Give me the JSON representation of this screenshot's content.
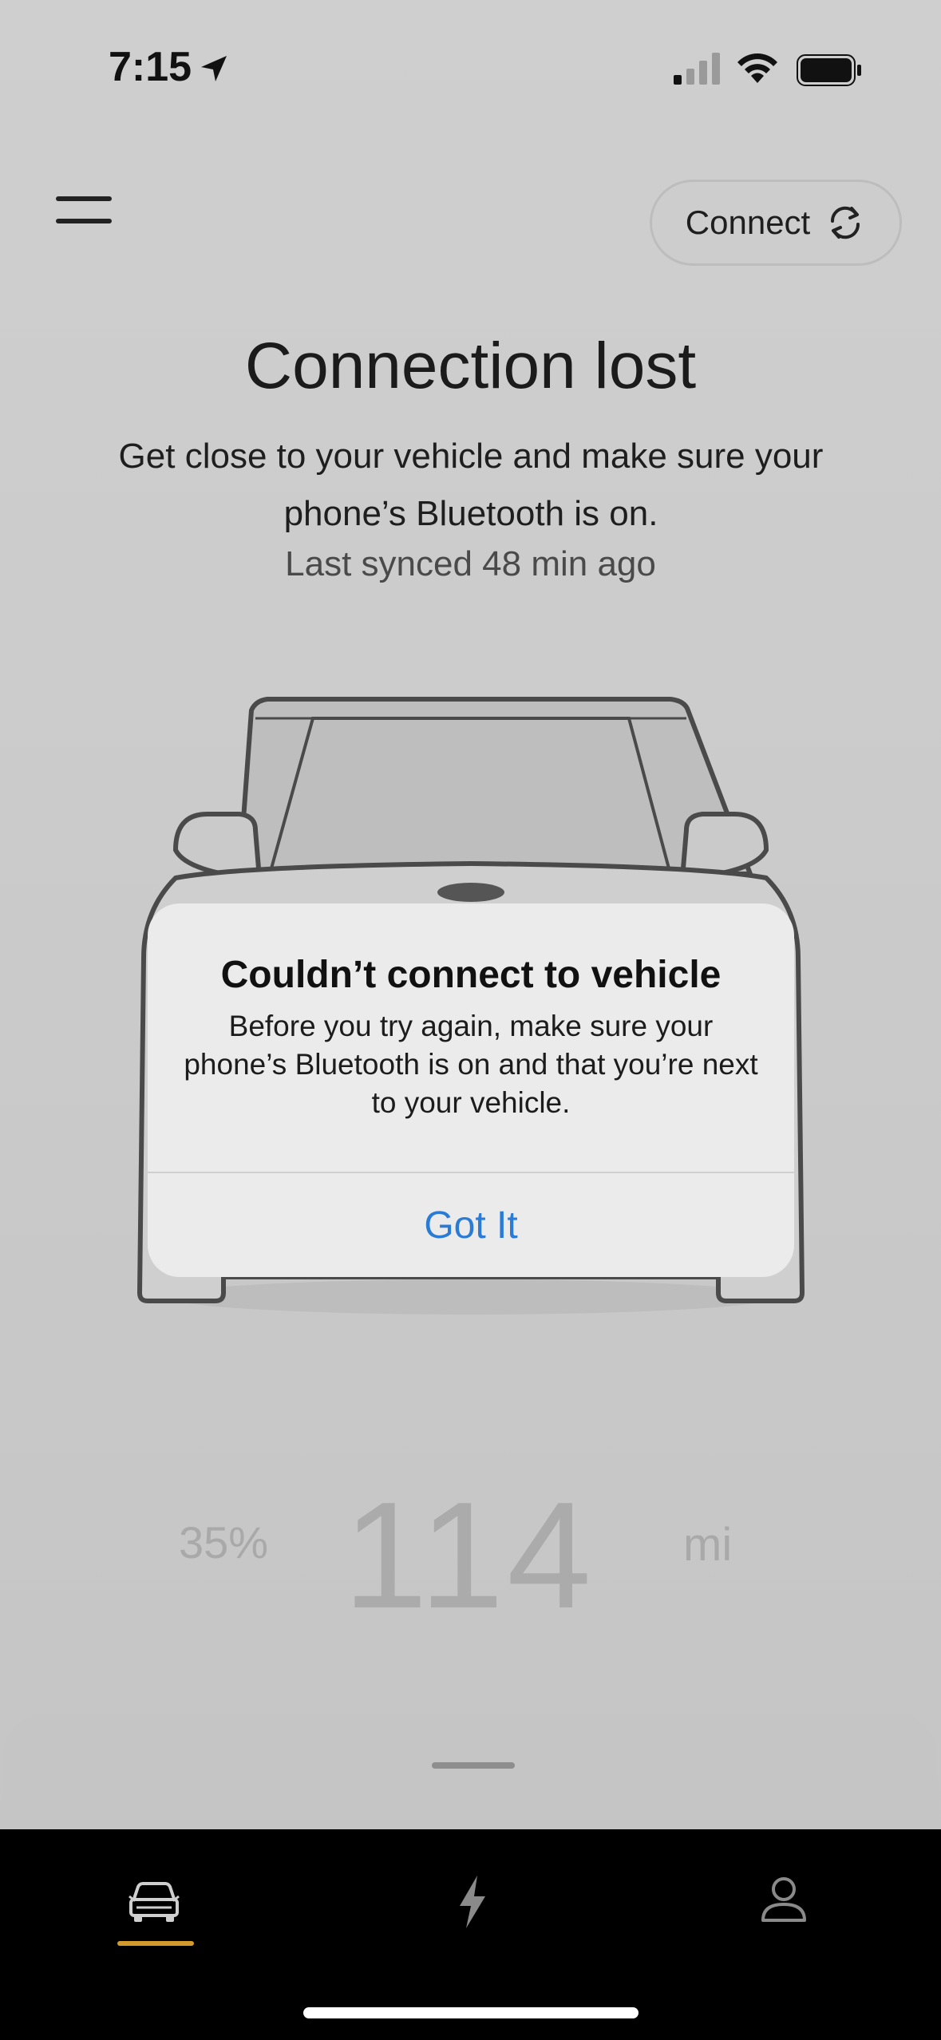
{
  "status_bar": {
    "time": "7:15"
  },
  "header": {
    "connect_label": "Connect"
  },
  "main": {
    "title": "Connection lost",
    "subtitle": "Get close to your vehicle and make sure your phone’s Bluetooth is on.",
    "last_synced": "Last synced 48 min ago"
  },
  "range": {
    "battery_percent": "35%",
    "value": "114",
    "unit": "mi"
  },
  "alert": {
    "title": "Couldn’t connect to vehicle",
    "message": "Before you try again, make sure your phone’s Bluetooth is on and that you’re next to your vehicle.",
    "button_label": "Got It"
  },
  "tabs": [
    {
      "icon": "car-icon",
      "selected": true
    },
    {
      "icon": "lightning-icon",
      "selected": false
    },
    {
      "icon": "person-icon",
      "selected": false
    }
  ],
  "colors": {
    "accent": "#d39a2c",
    "alert_button": "#2a7bd6",
    "tabbar_bg": "#000000"
  }
}
